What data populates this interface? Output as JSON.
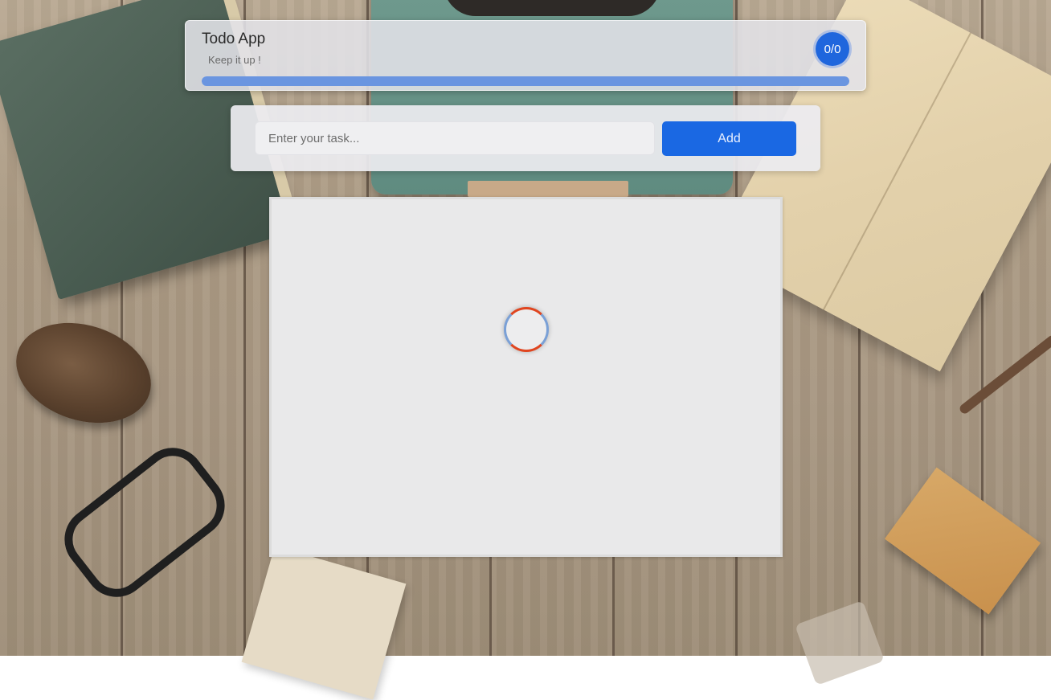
{
  "app": {
    "title": "Todo App",
    "subtitle": "Keep it up !",
    "counter": "0/0",
    "progress_fraction": 1.0
  },
  "task_form": {
    "input_value": "",
    "input_placeholder": "Enter your task...",
    "add_label": "Add"
  },
  "task_list": {
    "state": "loading",
    "items": []
  },
  "colors": {
    "accent": "#1a68e3",
    "counter_badge": "#1f66dd",
    "progress_fill": "#6a95e0",
    "spinner_primary": "#e0451f",
    "spinner_secondary": "#7aa0d6",
    "panel_background": "#e9e9ea"
  }
}
